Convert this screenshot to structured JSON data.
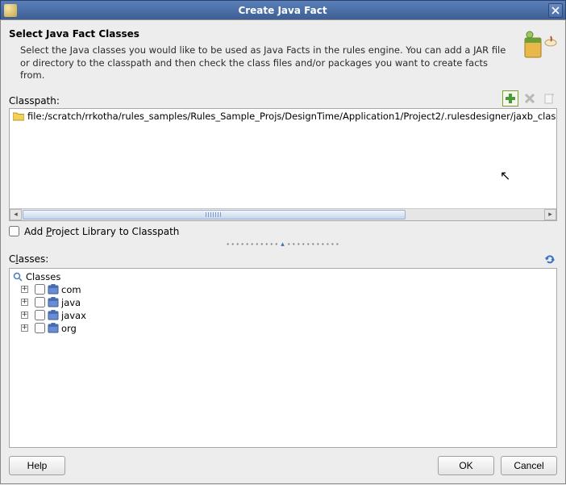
{
  "window": {
    "title": "Create Java Fact"
  },
  "header": {
    "title": "Select Java Fact Classes",
    "description": "Select the Java classes you would like to be used as Java Facts in the rules engine.\nYou can add a JAR file or directory to the classpath and then check the class files and/or packages you want to create facts from."
  },
  "classpath": {
    "label": "Classpath:",
    "items": [
      "file:/scratch/rrkotha/rules_samples/Rules_Sample_Projs/DesignTime/Application1/Project2/.rulesdesigner/jaxb_classes"
    ],
    "add_tooltip": "Add",
    "remove_tooltip": "Remove",
    "clear_tooltip": "Clear"
  },
  "options": {
    "add_project_library_label": "Add Project Library to Classpath",
    "add_project_library_checked": false
  },
  "classes": {
    "label": "Classes:",
    "root_label": "Classes",
    "packages": [
      {
        "name": "com",
        "checked": false
      },
      {
        "name": "java",
        "checked": false
      },
      {
        "name": "javax",
        "checked": false
      },
      {
        "name": "org",
        "checked": false
      }
    ],
    "refresh_tooltip": "Refresh"
  },
  "buttons": {
    "help": "Help",
    "ok": "OK",
    "cancel": "Cancel"
  }
}
